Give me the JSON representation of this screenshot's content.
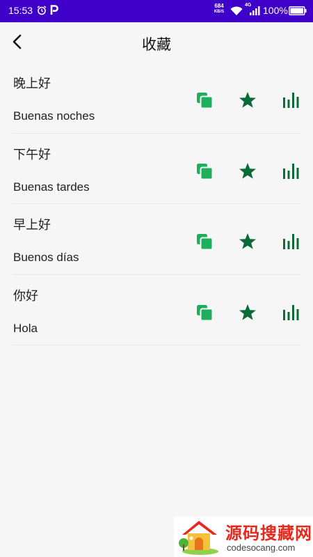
{
  "status_bar": {
    "time": "15:53",
    "net_speed_value": "684",
    "net_speed_unit": "KB/S",
    "network_type": "4G",
    "battery_text": "100%"
  },
  "header": {
    "title": "收藏"
  },
  "favorites": [
    {
      "chinese": "晚上好",
      "spanish": "Buenas noches"
    },
    {
      "chinese": "下午好",
      "spanish": "Buenas tardes"
    },
    {
      "chinese": "早上好",
      "spanish": "Buenos días"
    },
    {
      "chinese": "你好",
      "spanish": "Hola"
    }
  ],
  "watermark": {
    "title": "源码搜藏网",
    "url": "codesocang.com"
  },
  "colors": {
    "status_bar": "#3f01c9",
    "copy_icon": "#1fae5b",
    "star_icon": "#0a6b37",
    "audio_icon": "#0a6b37",
    "watermark_title": "#e8281c"
  },
  "icons": {
    "back": "back-arrow-icon",
    "copy": "copy-icon",
    "favorite": "star-icon",
    "audio": "audio-bars-icon"
  }
}
